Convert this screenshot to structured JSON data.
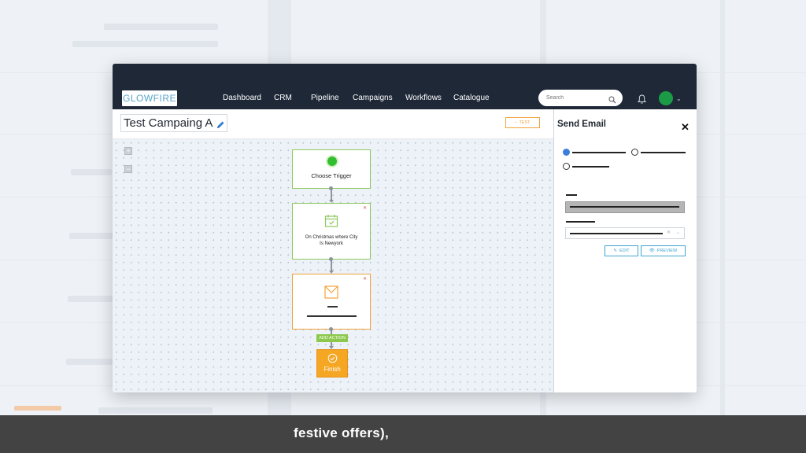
{
  "nav": {
    "logo_text": "GLOWFIRE",
    "items": [
      "Dashboard",
      "CRM",
      "Pipeline",
      "Campaigns",
      "Workflows",
      "Catalogue"
    ],
    "search_placeholder": "Search",
    "icons": [
      "search-icon",
      "bell-icon",
      "avatar",
      "chevron-down-icon"
    ]
  },
  "campaign": {
    "title": "Test Campaing A",
    "test_button": "TEST"
  },
  "canvas": {
    "zoom_in": "+",
    "zoom_out": "−",
    "nodes": [
      {
        "label": "Choose Trigger",
        "icon": "trigger-dot-icon"
      },
      {
        "label": "On Christmas where City Is Newyork",
        "icon": "calendar-icon"
      },
      {
        "label": "",
        "icon": "envelope-icon"
      }
    ],
    "add_action": "ADD ACTION",
    "finish": "Finish"
  },
  "panel": {
    "title": "Send Email",
    "close": "✕",
    "edit_button": "EDIT",
    "preview_button": "PREVIEW"
  },
  "colors": {
    "topbar": "#1e2837",
    "node_border": "#8ec85e",
    "accent_orange": "#f5a623",
    "link_blue": "#3fa5d1",
    "radio_selected": "#3b7fd9"
  },
  "caption": "festive offers),"
}
